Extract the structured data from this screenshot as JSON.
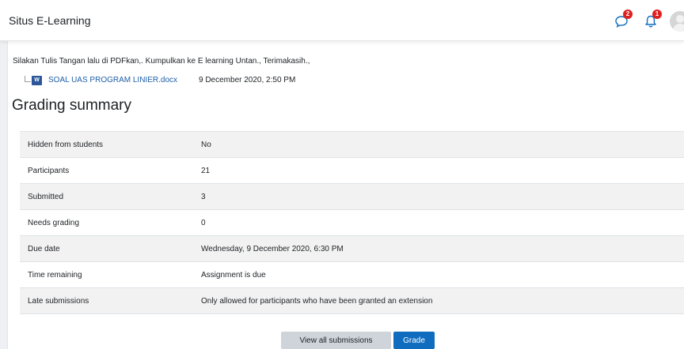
{
  "navbar": {
    "site_name": "Situs E-Learning",
    "messages_badge": "2",
    "notifications_badge": "1"
  },
  "intro": {
    "text": "Silakan Tulis Tangan lalu di PDFkan,. Kumpulkan ke E learning Untan., Terimakasih.,"
  },
  "attachment": {
    "icon_text": "W",
    "file_name": "SOAL UAS PROGRAM LINIER.docx",
    "date": "9 December 2020, 2:50 PM"
  },
  "grading": {
    "heading": "Grading summary",
    "rows": [
      {
        "label": "Hidden from students",
        "value": "No"
      },
      {
        "label": "Participants",
        "value": "21"
      },
      {
        "label": "Submitted",
        "value": "3"
      },
      {
        "label": "Needs grading",
        "value": "0"
      },
      {
        "label": "Due date",
        "value": "Wednesday, 9 December 2020, 6:30 PM"
      },
      {
        "label": "Time remaining",
        "value": "Assignment is due"
      },
      {
        "label": "Late submissions",
        "value": "Only allowed for participants who have been granted an extension"
      }
    ]
  },
  "actions": {
    "view_all_label": "View all submissions",
    "grade_label": "Grade"
  },
  "colors": {
    "accent": "#0f6cbf",
    "badge": "#e02020",
    "link": "#1f5fa8"
  },
  "icons": {
    "messages": "message-bubble-icon",
    "notifications": "bell-icon",
    "file": "word-document-icon"
  }
}
